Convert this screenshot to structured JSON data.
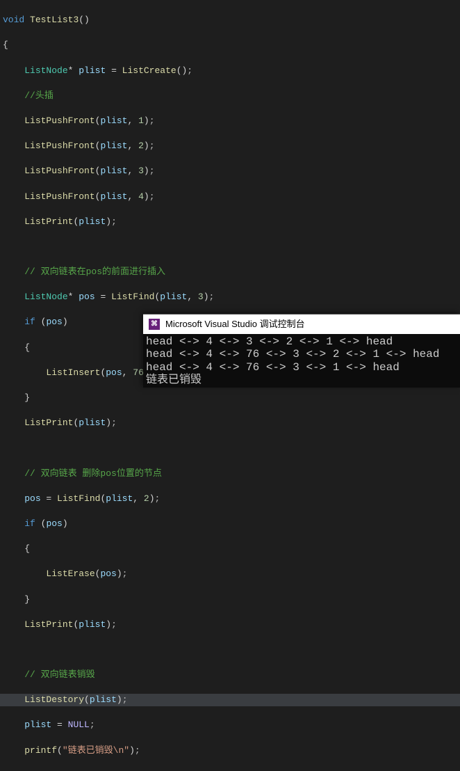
{
  "code": {
    "l1_kw": "void",
    "l1_fn": "TestList3",
    "l1_rest": "()",
    "l2": "{",
    "l3_type": "ListNode",
    "l3_var": "plist",
    "l3_fn": "ListCreate",
    "l4_cmt": "//头插",
    "l5_fn": "ListPushFront",
    "l5_var": "plist",
    "l5_n": "1",
    "l6_fn": "ListPushFront",
    "l6_var": "plist",
    "l6_n": "2",
    "l7_fn": "ListPushFront",
    "l7_var": "plist",
    "l7_n": "3",
    "l8_fn": "ListPushFront",
    "l8_var": "plist",
    "l8_n": "4",
    "l9_fn": "ListPrint",
    "l9_var": "plist",
    "l11_cmt": "// 双向链表在pos的前面进行插入",
    "l12_type": "ListNode",
    "l12_var": "pos",
    "l12_fn": "ListFind",
    "l12_arg": "plist",
    "l12_n": "3",
    "l13_kw": "if",
    "l13_var": "pos",
    "l14": "{",
    "l15_fn": "ListInsert",
    "l15_var": "pos",
    "l15_n": "76",
    "l16": "}",
    "l17_fn": "ListPrint",
    "l17_var": "plist",
    "l19_cmt": "// 双向链表 删除pos位置的节点",
    "l20_var": "pos",
    "l20_fn": "ListFind",
    "l20_arg": "plist",
    "l20_n": "2",
    "l21_kw": "if",
    "l21_var": "pos",
    "l22": "{",
    "l23_fn": "ListErase",
    "l23_var": "pos",
    "l24": "}",
    "l25_fn": "ListPrint",
    "l25_var": "plist",
    "l27_cmt": "// 双向链表销毁",
    "l28_fn": "ListDestory",
    "l28_var": "plist",
    "l29_var": "plist",
    "l29_macro": "NULL",
    "l30_fn": "printf",
    "l30_str": "\"链表已销毁\\n\""
  },
  "console": {
    "title": "Microsoft Visual Studio 调试控制台",
    "icon_text": "⌘",
    "out1": "head <-> 4 <-> 3 <-> 2 <-> 1 <-> head",
    "out2": "head <-> 4 <-> 76 <-> 3 <-> 2 <-> 1 <-> head",
    "out3": "head <-> 4 <-> 76 <-> 3 <-> 1 <-> head",
    "out4": "链表已销毁"
  }
}
